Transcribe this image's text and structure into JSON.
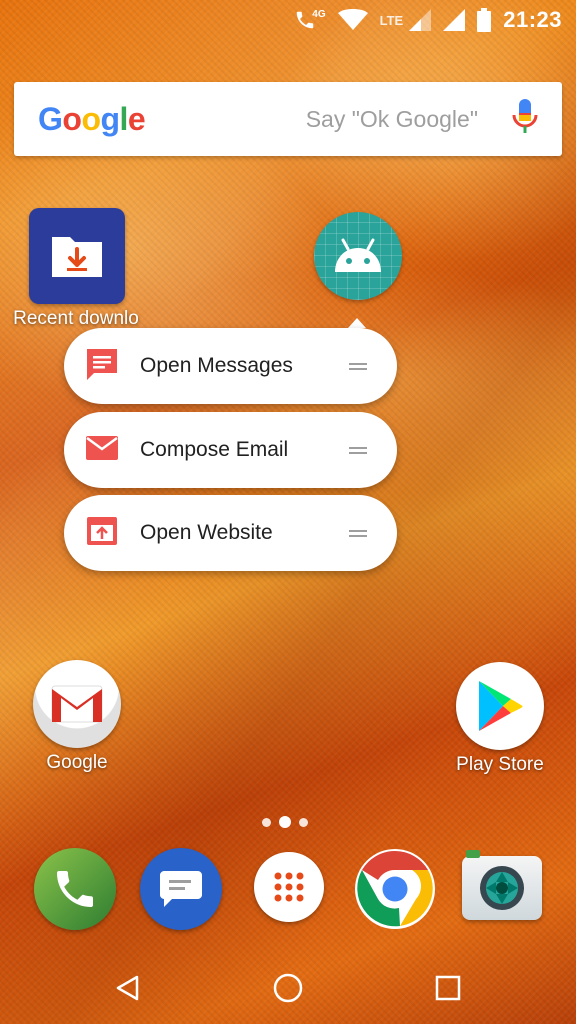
{
  "status_bar": {
    "network_badge": "4G",
    "lte_label": "LTE",
    "time": "21:23"
  },
  "search": {
    "hint": "Say \"Ok Google\"",
    "logo_letters": [
      "G",
      "o",
      "o",
      "g",
      "l",
      "e"
    ]
  },
  "apps": {
    "recent_downloads": "Recent downlo",
    "google_folder": "Google",
    "play_store": "Play Store"
  },
  "shortcuts": [
    {
      "label": "Open Messages",
      "icon": "message-icon"
    },
    {
      "label": "Compose Email",
      "icon": "email-icon"
    },
    {
      "label": "Open Website",
      "icon": "open-web-icon"
    }
  ],
  "dock": [
    "phone-icon",
    "messages-icon",
    "app-drawer-icon",
    "chrome-icon",
    "camera-icon"
  ],
  "nav": [
    "back-icon",
    "home-icon",
    "recents-icon"
  ],
  "colors": {
    "shortcut_icon_red": "#ef5350",
    "recent_downloads_bg": "#2c3c9a",
    "android_app_bg": "#2aa39a"
  }
}
